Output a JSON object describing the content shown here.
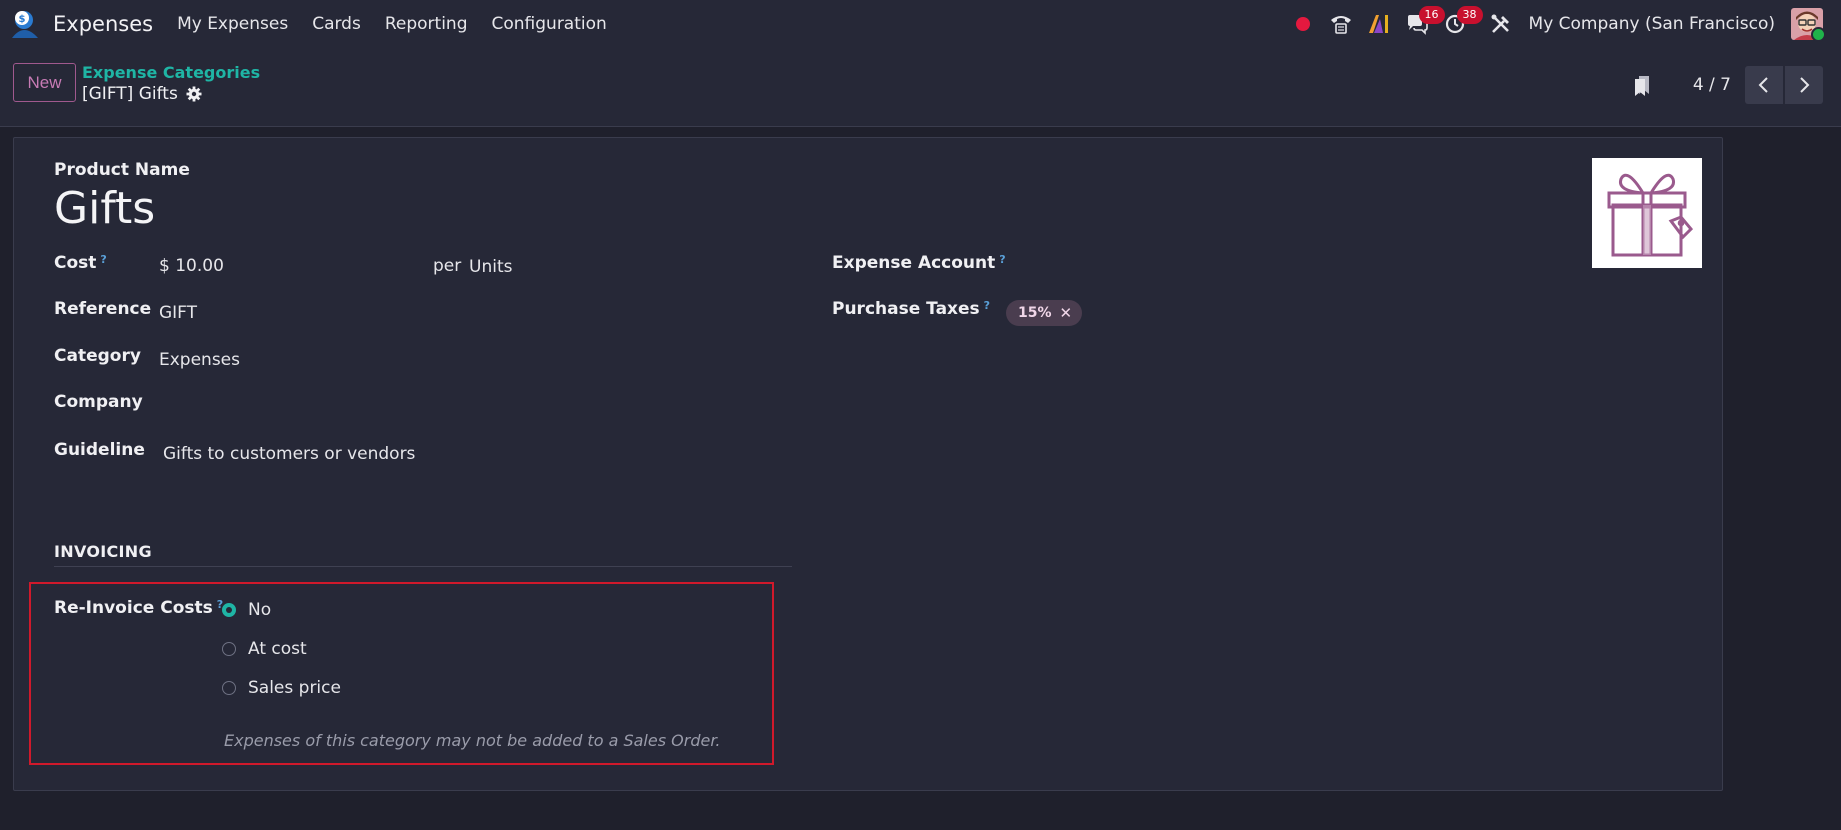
{
  "app": {
    "name": "Expenses"
  },
  "menu": [
    "My Expenses",
    "Cards",
    "Reporting",
    "Configuration"
  ],
  "systray": {
    "messages_count": "16",
    "activities_count": "38",
    "company": "My Company (San Francisco)"
  },
  "control": {
    "new_label": "New",
    "breadcrumb_parent": "Expense Categories",
    "breadcrumb_current": "[GIFT] Gifts",
    "pager": "4 / 7"
  },
  "form": {
    "product_name_label": "Product Name",
    "product_name": "Gifts",
    "cost_label": "Cost",
    "cost_value": "$ 10.00",
    "per_label": "per",
    "uom": "Units",
    "reference_label": "Reference",
    "reference_value": "GIFT",
    "category_label": "Category",
    "category_value": "Expenses",
    "company_label": "Company",
    "guideline_label": "Guideline",
    "guideline_value": "Gifts to customers or vendors",
    "expense_account_label": "Expense Account",
    "purchase_taxes_label": "Purchase Taxes",
    "purchase_tax_tag": "15%",
    "help_mark": "?"
  },
  "invoicing": {
    "section_title": "INVOICING",
    "reinvoice_label": "Re-Invoice Costs",
    "options": [
      "No",
      "At cost",
      "Sales price"
    ],
    "selected": "No",
    "hint": "Expenses of this category may not be added to a Sales Order."
  },
  "colors": {
    "accent_teal": "#1fb5a5",
    "primary_purple": "#a0598e",
    "highlight_red": "#d0192b",
    "badge_red": "#c8102e"
  }
}
